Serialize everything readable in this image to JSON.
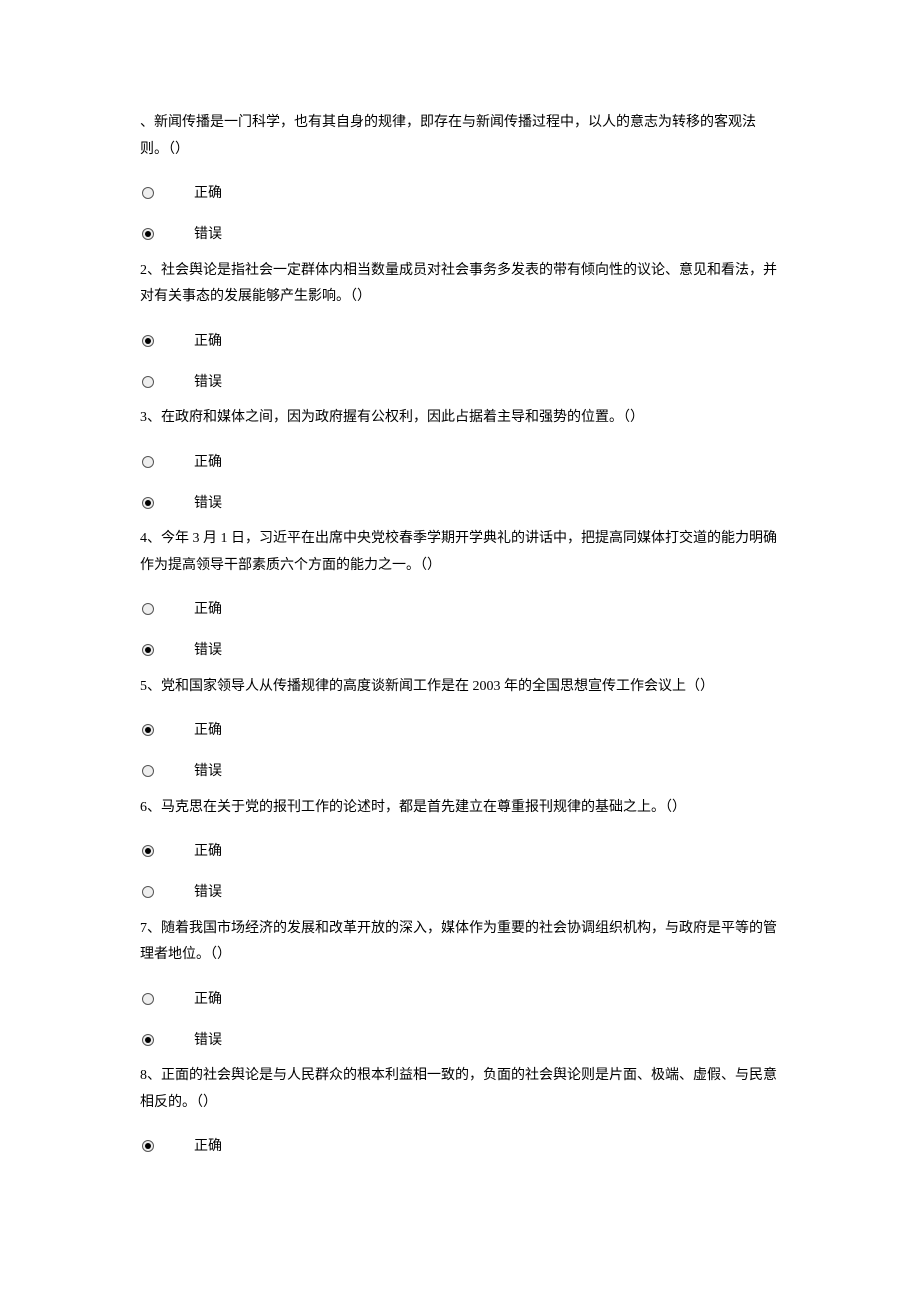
{
  "labels": {
    "correct": "正确",
    "incorrect": "错误"
  },
  "questions": [
    {
      "text": "、新闻传播是一门科学，也有其自身的规律，即存在与新闻传播过程中，以人的意志为转移的客观法则。（）",
      "selected": "incorrect"
    },
    {
      "text": "2、社会舆论是指社会一定群体内相当数量成员对社会事务多发表的带有倾向性的议论、意见和看法，并对有关事态的发展能够产生影响。（）",
      "selected": "correct"
    },
    {
      "text": "3、在政府和媒体之间，因为政府握有公权利，因此占据着主导和强势的位置。（）",
      "selected": "incorrect"
    },
    {
      "text": "4、今年 3 月 1 日，习近平在出席中央党校春季学期开学典礼的讲话中，把提高同媒体打交道的能力明确作为提高领导干部素质六个方面的能力之一。（）",
      "selected": "incorrect"
    },
    {
      "text": "5、党和国家领导人从传播规律的高度谈新闻工作是在 2003 年的全国思想宣传工作会议上（）",
      "selected": "correct"
    },
    {
      "text": "6、马克思在关于党的报刊工作的论述时，都是首先建立在尊重报刊规律的基础之上。（）",
      "selected": "correct"
    },
    {
      "text": "7、随着我国市场经济的发展和改革开放的深入，媒体作为重要的社会协调组织机构，与政府是平等的管理者地位。（）",
      "selected": "incorrect"
    },
    {
      "text": "8、正面的社会舆论是与人民群众的根本利益相一致的，负面的社会舆论则是片面、极端、虚假、与民意相反的。（）",
      "selected": "correct",
      "only_first": true
    }
  ]
}
